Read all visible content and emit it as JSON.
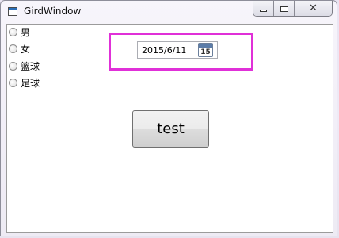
{
  "window": {
    "title": "GirdWindow",
    "close_symbol": "✕"
  },
  "radios": [
    {
      "label": "男",
      "checked": false
    },
    {
      "label": "女",
      "checked": false
    },
    {
      "label": "篮球",
      "checked": false
    },
    {
      "label": "足球",
      "checked": false
    }
  ],
  "datepicker": {
    "value": "2015/6/11",
    "calendar_day": "15",
    "icon": "calendar-icon"
  },
  "button": {
    "label": "test"
  },
  "colors": {
    "highlight": "#e030d8"
  }
}
